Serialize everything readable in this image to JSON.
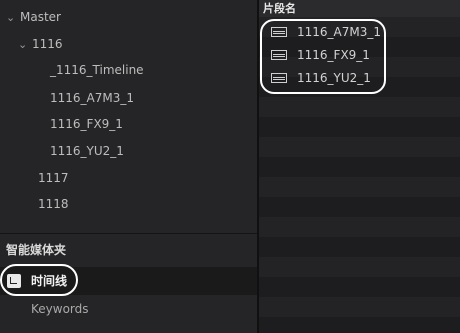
{
  "bin_tree": {
    "master": "Master",
    "bin_1116": "1116",
    "children": [
      "_1116_Timeline",
      "1116_A7M3_1",
      "1116_FX9_1",
      "1116_YU2_1"
    ],
    "bin_1117": "1117",
    "bin_1118": "1118"
  },
  "smart_bins": {
    "header": "智能媒体夹",
    "timeline_label": "时间线",
    "keywords_label": "Keywords"
  },
  "clip_list": {
    "column_header": "片段名",
    "clips": [
      "1116_A7M3_1",
      "1116_FX9_1",
      "1116_YU2_1"
    ]
  },
  "icons": {
    "collapse": "chevron-down-icon",
    "clip": "clip-icon",
    "timeline": "timeline-icon"
  },
  "colors": {
    "highlight": "#ffffff",
    "panel_bg": "#252527"
  }
}
